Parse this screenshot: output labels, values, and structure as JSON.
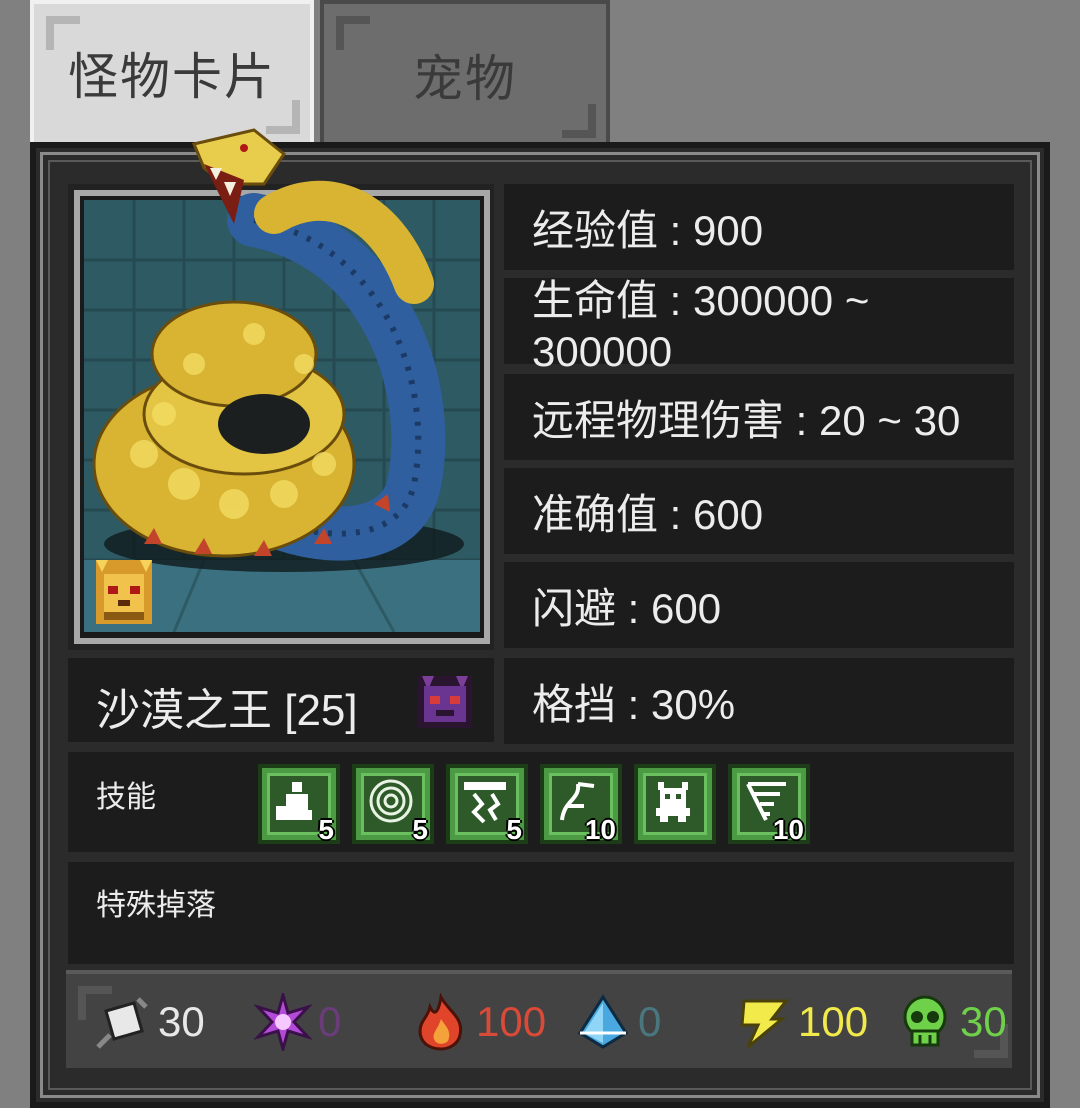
{
  "tabs": [
    {
      "label": "怪物卡片",
      "active": true
    },
    {
      "label": "宠物",
      "active": false
    }
  ],
  "monster": {
    "name": "沙漠之王 [25]",
    "portrait_icon": "golden-sandworm-icon",
    "rank_icon": "golden-lion-icon",
    "elite_icon": "purple-demon-mask-icon"
  },
  "stats": [
    "经验值 : 900",
    "生命值 : 300000 ~ 300000",
    "远程物理伤害 : 20 ~ 30",
    "准确值 : 600",
    "闪避 : 600",
    "格挡 : 30%"
  ],
  "skills": {
    "label": "技能",
    "items": [
      {
        "icon": "summon-figure-skill-icon",
        "count": "5"
      },
      {
        "icon": "vortex-skill-icon",
        "count": "5"
      },
      {
        "icon": "lightning-storm-skill-icon",
        "count": "5"
      },
      {
        "icon": "burrow-skill-icon",
        "count": "10"
      },
      {
        "icon": "beast-skill-icon",
        "count": ""
      },
      {
        "icon": "tornado-skill-icon",
        "count": "10"
      }
    ]
  },
  "drops": {
    "label": "特殊掉落"
  },
  "resistances": [
    {
      "icon": "physical-sword-icon",
      "value": "30",
      "color": "#e8e8e8"
    },
    {
      "icon": "arcane-magic-icon",
      "value": "0",
      "color": "#6a3d7a"
    },
    {
      "icon": "fire-icon",
      "value": "100",
      "color": "#d94a38"
    },
    {
      "icon": "ice-crystal-icon",
      "value": "0",
      "color": "#4a7680"
    },
    {
      "icon": "lightning-icon",
      "value": "100",
      "color": "#f2ea4a"
    },
    {
      "icon": "poison-skull-icon",
      "value": "30",
      "color": "#6fd14a"
    }
  ]
}
